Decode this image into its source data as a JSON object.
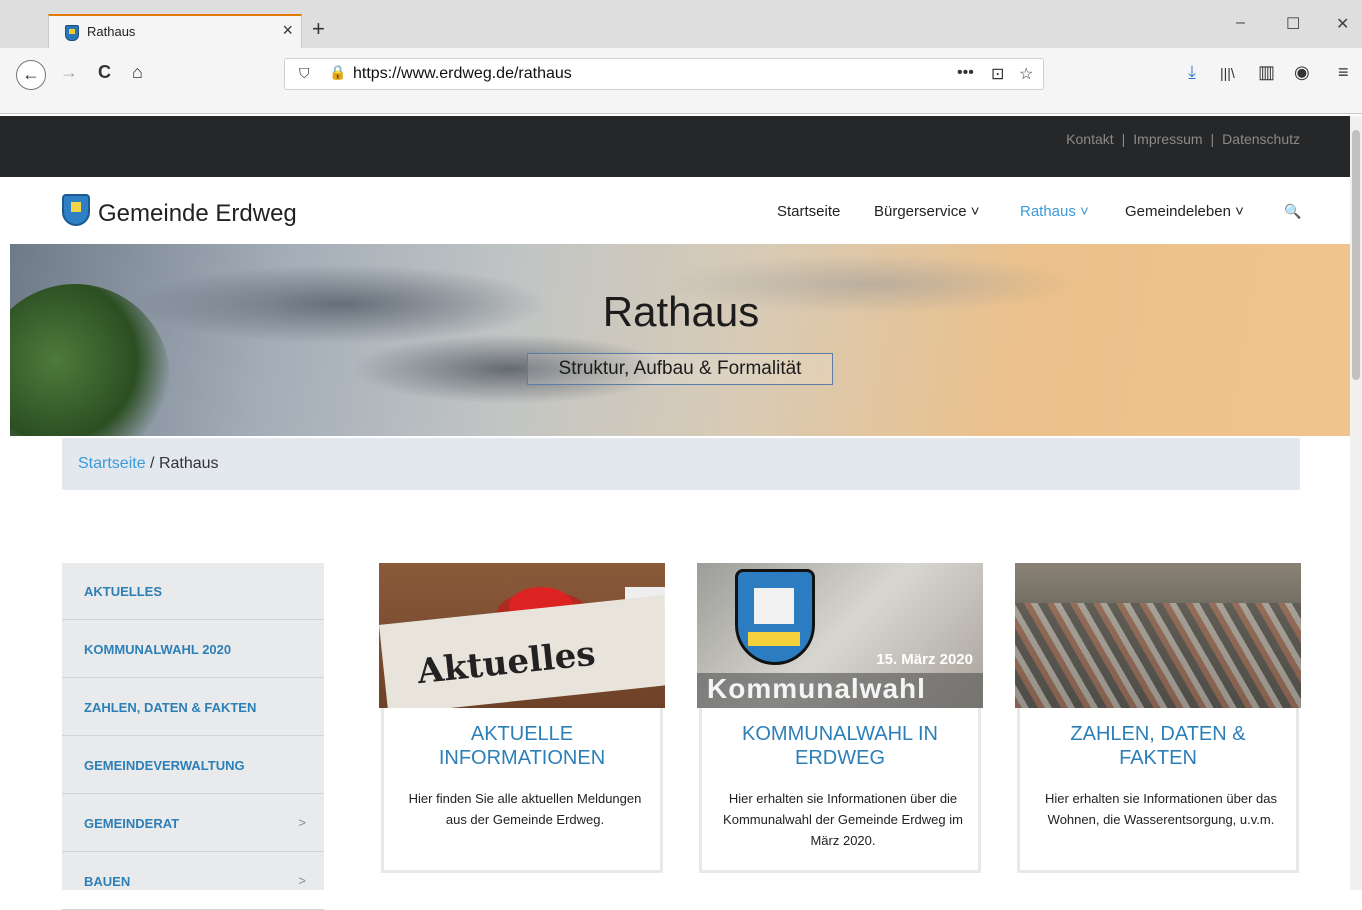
{
  "browser": {
    "tab_title": "Rathaus",
    "tab_close": "×",
    "new_tab": "+",
    "window_buttons": [
      "–",
      "☐",
      "✕"
    ],
    "url": "https://www.erdweg.de/rathaus",
    "nav_icons": {
      "back": "←",
      "forward": "→",
      "reload": "C",
      "home": "⌂"
    },
    "url_right_icons": [
      "•••",
      "⊡",
      "☆"
    ],
    "toolbar_icons": [
      "⤓",
      "|||\\",
      "▥",
      "◉",
      "≡"
    ],
    "accent": "#e47a00"
  },
  "top_links": [
    {
      "label": "Kontakt"
    },
    {
      "label": "Impressum"
    },
    {
      "label": "Datenschutz"
    }
  ],
  "top_link_separator": "|",
  "site": {
    "name": "Gemeinde Erdweg",
    "menu": [
      {
        "label": "Startseite",
        "active": false
      },
      {
        "label": "Bürgerservice ˅",
        "active": false
      },
      {
        "label": "Rathaus ˅",
        "active": true
      },
      {
        "label": "Gemeindeleben ˅",
        "active": false
      }
    ],
    "search_icon": "🔍"
  },
  "hero": {
    "title": "Rathaus",
    "subtitle": "Struktur, Aufbau & Formalität"
  },
  "breadcrumb": {
    "home": "Startseite",
    "separator": " / ",
    "current": "Rathaus"
  },
  "sidebar": {
    "items": [
      {
        "label": "AKTUELLES",
        "chevron": ""
      },
      {
        "label": "KOMMUNALWAHL 2020",
        "chevron": ""
      },
      {
        "label": "ZAHLEN, DATEN & FAKTEN",
        "chevron": ""
      },
      {
        "label": "GEMEINDEVERWALTUNG",
        "chevron": ""
      },
      {
        "label": "GEMEINDERAT",
        "chevron": ">"
      },
      {
        "label": "BAUEN",
        "chevron": ">"
      }
    ]
  },
  "cards": [
    {
      "image_text": "Aktuelles",
      "title_line1": "AKTUELLE",
      "title_line2": "INFORMATIONEN",
      "text": "Hier finden Sie alle aktuellen Meldungen aus der Gemeinde Erdweg."
    },
    {
      "image_date": "15. März 2020",
      "image_text": "Kommunalwahl",
      "title_line1": "KOMMUNALWAHL IN",
      "title_line2": "ERDWEG",
      "text": "Hier erhalten sie Informationen über die Kommunalwahl der Gemeinde Erdweg im März 2020."
    },
    {
      "title_line1": "ZAHLEN, DATEN &",
      "title_line2": "FAKTEN",
      "text": "Hier erhalten sie Informationen über das Wohnen, die Wasserentsorgung, u.v.m."
    }
  ],
  "colors": {
    "link": "#3b9ad9",
    "topbar": "#262728",
    "sidebar_bg": "#e9eaeb",
    "breadcrumb_bg": "#e3e8ee"
  }
}
